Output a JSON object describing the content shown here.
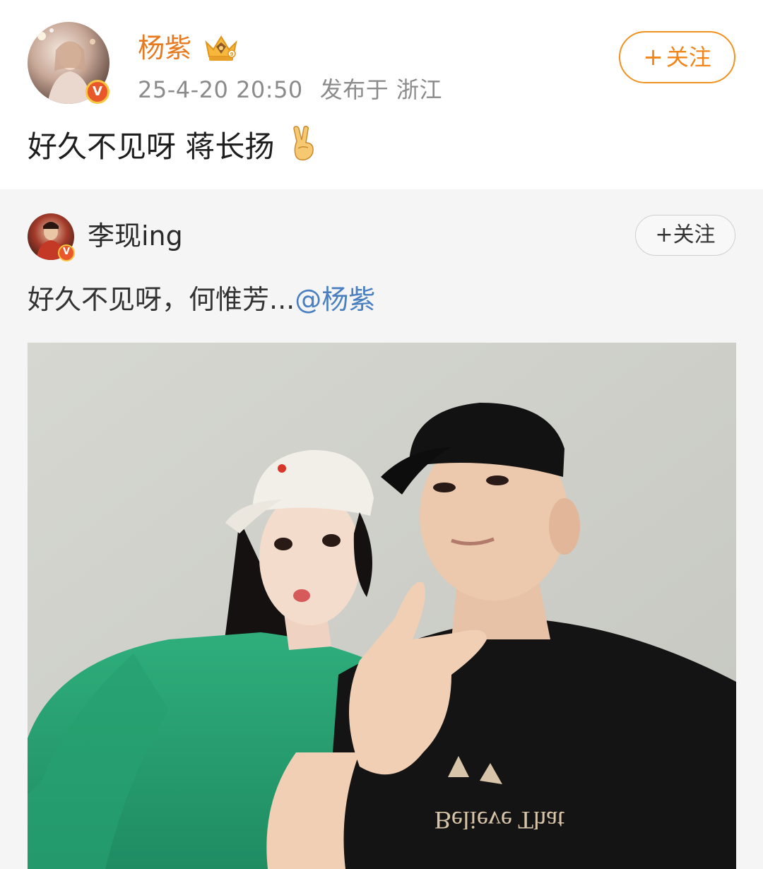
{
  "post": {
    "author": "杨紫",
    "timestamp": "25-4-20 20:50",
    "location": "发布于 浙江",
    "text": "好久不见呀 蒋长扬",
    "follow_label": "关注",
    "follow_plus": "+",
    "verified_badge": "V",
    "crown_icon": "crown-icon",
    "emoji": "victory-hand-icon"
  },
  "repost": {
    "author": "李现ing",
    "follow_label": "关注",
    "follow_plus": "+",
    "verified_badge": "V",
    "text": "好久不见呀，何惟芳...",
    "mention": "@杨紫",
    "tshirt_print": "Believe That"
  },
  "colors": {
    "accent_orange": "#f0921f",
    "author_orange": "#e77a1f",
    "mention_blue": "#4a7fc0",
    "meta_gray": "#8b8b8b",
    "card_bg": "#f5f5f5"
  }
}
